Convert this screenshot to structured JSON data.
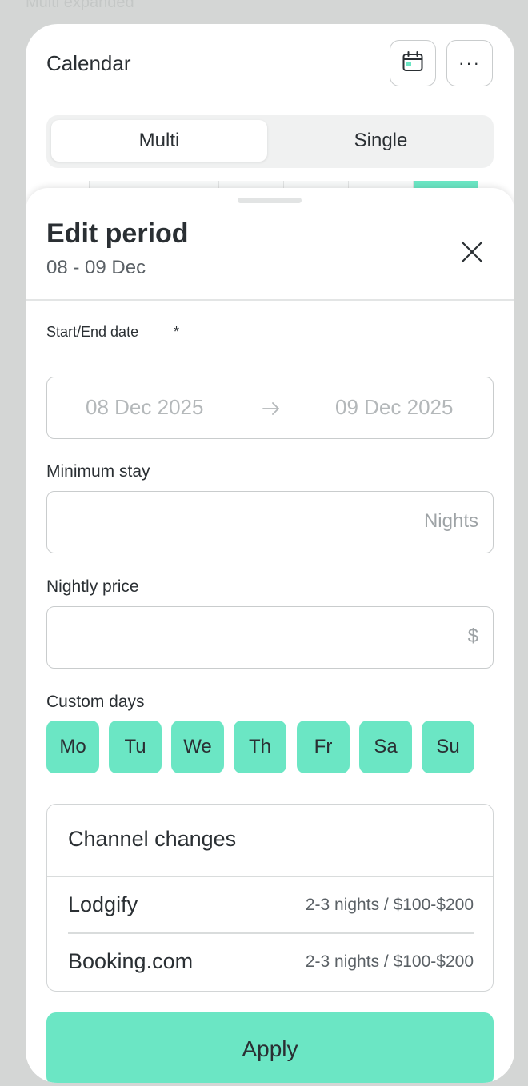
{
  "frame_label": "Multi expanded",
  "header": {
    "title": "Calendar",
    "more_glyph": "···"
  },
  "view_toggle": {
    "options": [
      "Multi",
      "Single"
    ],
    "selected": "Multi"
  },
  "sheet": {
    "title": "Edit period",
    "subtitle": "08 - 09 Dec",
    "start_end": {
      "label": "Start/End date",
      "required_mark": "*",
      "start_placeholder": "08 Dec 2025",
      "end_placeholder": "09 Dec 2025"
    },
    "minimum_stay": {
      "label": "Minimum stay",
      "suffix": "Nights"
    },
    "nightly_price": {
      "label": "Nightly price",
      "suffix": "$"
    },
    "custom_days": {
      "label": "Custom days",
      "days": [
        "Mo",
        "Tu",
        "We",
        "Th",
        "Fr",
        "Sa",
        "Su"
      ]
    },
    "channel_changes": {
      "title": "Channel changes",
      "channels": [
        {
          "name": "Lodgify",
          "detail": "2-3 nights / $100-$200"
        },
        {
          "name": "Booking.com",
          "detail": "2-3 nights / $100-$200"
        }
      ]
    },
    "apply_label": "Apply"
  },
  "colors": {
    "accent": "#6be6c4",
    "background": "#d4d6d5",
    "text": "#2a2f33",
    "placeholder": "#b4b8ba"
  },
  "icons": {
    "calendar": "calendar-icon",
    "more": "more-horizontal-icon",
    "close": "close-icon",
    "arrow": "arrow-right-icon"
  }
}
